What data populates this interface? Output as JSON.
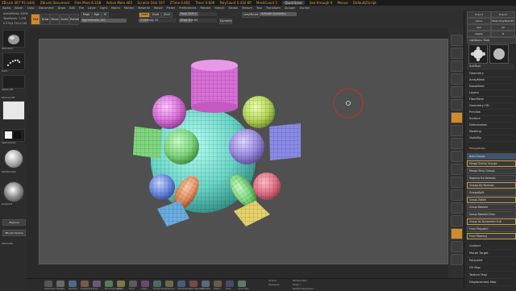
{
  "titlebar": {
    "app": "ZBrush 4R7 P3 (x64)",
    "doc": "ZBrush Document",
    "free_mem": "Free Mem 8.1GB",
    "active_mem": "Active Mem 465",
    "scratch": "Scratch Disk 197",
    "ztime": "ZTime 0.692",
    "timer": "Timer 0.609",
    "polycount": "PolyCount 0.416 KP",
    "meshcount": "MeshCount 1",
    "quicksave": "QuickSave",
    "seethrough": "See-through 0",
    "menus": "Menus",
    "defaultzscript": "DefaultZScript"
  },
  "menubar": [
    "Alpha",
    "Brush",
    "Color",
    "Document",
    "Draw",
    "Edit",
    "File",
    "Layer",
    "Light",
    "Macro",
    "Marker",
    "Material",
    "Movie",
    "Picker",
    "Preferences",
    "Render",
    "Stencil",
    "Stroke",
    "Texture",
    "Tool",
    "Transform",
    "Zplugin",
    "Zscript"
  ],
  "shelf": {
    "active_points": "ActivePoints: 6,804",
    "total_points": "TotalPoints: 7,238",
    "coords": "0.274,0.734,0.245",
    "buttons": [
      {
        "label": "Edit",
        "on": true
      },
      {
        "label": "Draw",
        "on": false
      },
      {
        "label": "Move",
        "on": false
      },
      {
        "label": "Scale",
        "on": false
      },
      {
        "label": "Rotate",
        "on": false
      }
    ],
    "mrgb": "Mrgb",
    "rgb": "Rgb",
    "m": "M",
    "zadd": "Zadd",
    "zsub": "Zsub",
    "zcut": "Zcut",
    "focal_shift": "Focal Shift 0",
    "draw_size": "Draw Size 64",
    "dynamic": "Dynamic",
    "rgb_intensity": "Rgb Intensity 100",
    "z_intensity": "Z Intensity 25",
    "lazy_mouse": "LazyMouse",
    "activate_symmetry": "Activate Symmetry",
    "sym_level": 0.52
  },
  "lefttray": {
    "labels": [
      "Standard",
      "DragRect",
      "Dots",
      "Alpha Off",
      "Texture Off",
      "SkinShade4",
      "Gradient",
      "SwitchColor",
      "Alternate"
    ],
    "buttons": [
      "ZSphere",
      "ZBrush Sphere"
    ]
  },
  "canvas": {
    "cursor_icon": "rotate-cursor-icon"
  },
  "bottomshelf": {
    "labels": [
      "SelectLasso",
      "MaskPen",
      "Standard",
      "ClayBuildup",
      "Move",
      "Move Topological",
      "hPolish",
      "Pinch",
      "Inflate",
      "TrimDynamic",
      "ClipCurve",
      "TrimAdaptive",
      "Dam Standard",
      "ZModeler",
      "Flatten",
      "Slash",
      "Curve Tube"
    ],
    "right_labels": [
      "Dynamic",
      "Backface Mask",
      "Topological",
      "Range 1",
      "Mask By Polygroups 0",
      "Backface"
    ]
  },
  "rightpanel": {
    "top_buttons": [
      "Import",
      "Export",
      "Clone",
      "Make PolyMesh3D",
      "Goz",
      "All",
      "Visible",
      "R"
    ],
    "lightbox": "Lightbox ▸ Tools",
    "tool_name": "PM3D_Sphere3D_1",
    "subtools_label": "SubTool",
    "items": [
      "Geometry",
      "ArrayMesh",
      "NanoMesh",
      "Layers",
      "FiberMesh",
      "Geometry HD",
      "Preview",
      "Surface",
      "Deformation",
      "Masking",
      "Visibility"
    ],
    "polygroups_header": "Polygroups",
    "auto_groups": "Auto Groups",
    "groups": [
      {
        "label": "Merge Similar Groups",
        "sel": true
      },
      {
        "label": "Merge Stray Groups",
        "sel": false
      },
      {
        "label": "Regroup By Normals",
        "sel": false
      },
      {
        "label": "Groups By Normals",
        "sel": true
      },
      {
        "label": "GroupsSplit",
        "sel": false
      },
      {
        "label": "Group Visible",
        "sel": true
      },
      {
        "label": "Group Masked",
        "sel": false
      },
      {
        "label": "Group Masked Clear",
        "sel": false
      },
      {
        "label": "Group As Dynamesh Sub",
        "sel": true
      },
      {
        "label": "From Polypaint",
        "sel": false
      },
      {
        "label": "From Masking",
        "sel": true
      }
    ],
    "bottom_items": [
      "Contact",
      "Morph Target",
      "Polypaint",
      "UV Map",
      "Texture Map",
      "Displacement Map"
    ]
  },
  "colors": {
    "accent": "#d08a2a",
    "bg": "#262626",
    "doc": "#505050",
    "mesh_cyan": "#6ad6c8",
    "mesh_magenta": "#d86ed8",
    "mesh_green": "#7ed67e",
    "mesh_lime": "#b4d65a",
    "mesh_violet": "#9a8ae0",
    "mesh_blue": "#8a8ae8",
    "mesh_orange": "#e08a5a",
    "mesh_yellow": "#e6d26a",
    "mesh_skyblue": "#6aaee0"
  }
}
